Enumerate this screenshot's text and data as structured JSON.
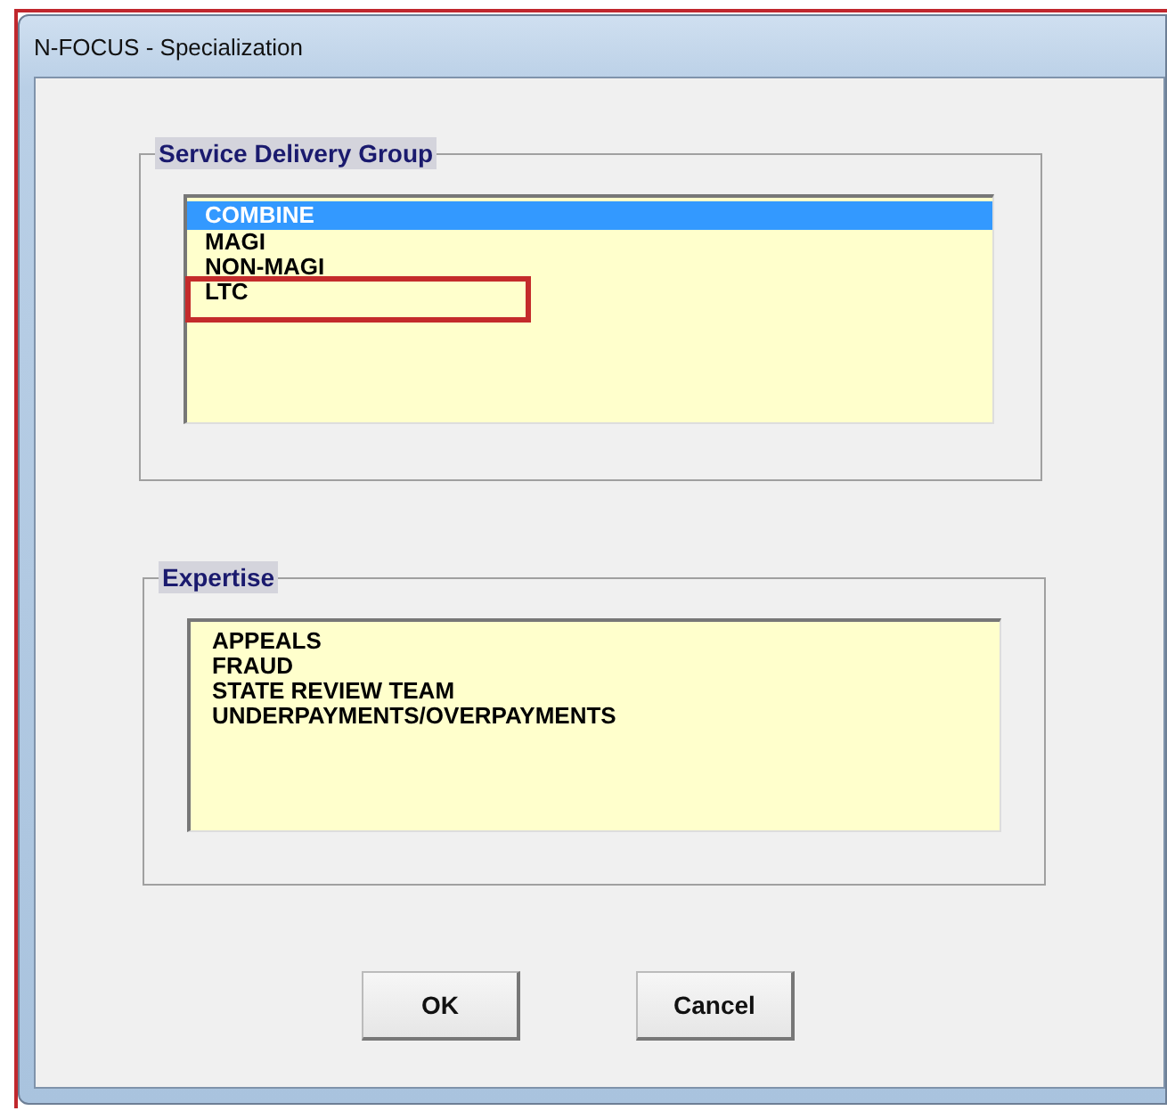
{
  "window": {
    "title": "N-FOCUS - Specialization"
  },
  "service_delivery_group": {
    "label": "Service Delivery Group",
    "items": [
      {
        "label": "COMBINE",
        "selected": true,
        "highlighted": false
      },
      {
        "label": "MAGI",
        "selected": false,
        "highlighted": false
      },
      {
        "label": "NON-MAGI",
        "selected": false,
        "highlighted": false
      },
      {
        "label": "LTC",
        "selected": false,
        "highlighted": true
      }
    ]
  },
  "expertise": {
    "label": "Expertise",
    "items": [
      {
        "label": "APPEALS",
        "selected": false
      },
      {
        "label": "FRAUD",
        "selected": false
      },
      {
        "label": "STATE REVIEW TEAM",
        "selected": false
      },
      {
        "label": "UNDERPAYMENTS/OVERPAYMENTS",
        "selected": false
      }
    ]
  },
  "buttons": [
    "OK",
    "Cancel"
  ]
}
